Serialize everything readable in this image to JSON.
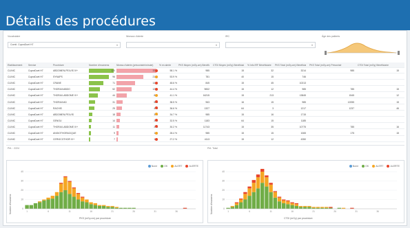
{
  "header": {
    "title": "Détails des procédures"
  },
  "filters": [
    {
      "label": "Vocabulaire",
      "value": "Comit. CupraDuet H7",
      "icon": "filter-icon"
    },
    {
      "label": "Niveaux d'alerte",
      "value": "",
      "icon": "chevron-down-icon"
    },
    {
      "label": "IRC",
      "value": "",
      "icon": "chevron-down-icon"
    },
    {
      "label": "Âge des patients",
      "value": "",
      "icon": ""
    }
  ],
  "table": {
    "columns": [
      "Établissement",
      "Service",
      "Procédure",
      "Nombre d'examens",
      "Niveau d'alerte (préconisée/minute)",
      "% en alerte",
      "PKS Moyen (mGy.cm) Bénéficiaire",
      "CTDI Moyen (mGy) Bénéficiaire",
      "% Info IRF Bénéficiaire",
      "PKS Total (mGy.cm) Bénéficiaire",
      "PKS Total (mGy.cm) Préconisé",
      "CTDI Total (mGy) Bénéficiaire"
    ],
    "rows": [
      [
        "CLINIC",
        "CupraDuet H7",
        "ABDOMEN-PELVIS IV+",
        120,
        3250,
        "58.1 %",
        "985",
        "15",
        "32",
        "3214",
        "985",
        "15"
      ],
      [
        "CLINIC",
        "CupraDuet H7",
        "SYNAPS",
        96,
        2160,
        "53.9 %",
        "781",
        "40",
        "15",
        "746",
        "",
        ""
      ],
      [
        "CLINIC",
        "CupraDuet H7",
        "CRANE",
        71,
        1485,
        "48.6 %",
        "845",
        "15",
        "45",
        "10213",
        "",
        ""
      ],
      [
        "CLINIC",
        "CupraDuet H7",
        "THORAX/ABDO",
        52,
        1210,
        "44.4 %",
        "9832",
        "15",
        "12",
        "985",
        "785",
        "15"
      ],
      [
        "CLINIC",
        "CupraDuet H7",
        "THORAX-ABDOME IV+",
        44,
        840,
        "41.1 %",
        "16215",
        "15",
        "213",
        "13845",
        "1545",
        "12"
      ],
      [
        "CLINIC",
        "CupraDuet H7",
        "THORAX/AD",
        31,
        525,
        "38.5 %",
        "963",
        "16",
        "15",
        "985",
        "12055",
        "15"
      ],
      [
        "CLINIC",
        "CupraDuet H7",
        "RACHIS",
        25,
        440,
        "36.6 %",
        "1327",
        "64",
        "3",
        "1217",
        "1237",
        "46"
      ],
      [
        "CLINIC",
        "CupraDuet H7",
        "ABDOMEN-PELVIS",
        18,
        310,
        "34.7 %",
        "985",
        "15",
        "16",
        "1715",
        "",
        ""
      ],
      [
        "CLINIC",
        "CupraDuet H7",
        "GENOU",
        14,
        260,
        "32.5 %",
        "1183",
        "64",
        "15",
        "1185",
        "",
        ""
      ],
      [
        "CLINIC",
        "CupraDuet H7",
        "THORAX-ABDOME IV+",
        11,
        215,
        "30.2 %",
        "11743",
        "15",
        "35",
        "10775",
        "785",
        "16"
      ],
      [
        "CLINIC",
        "CupraDuet H7",
        "ANGIOTHORACIQUE",
        9,
        180,
        "28.4 %",
        "985",
        "15",
        "15",
        "1065",
        "175",
        "15"
      ],
      [
        "CLINIC",
        "CupraDuet H7",
        "CERVICOTHOR IV+",
        7,
        140,
        "27.2 %",
        "4113",
        "15",
        "12",
        "4350",
        "",
        ""
      ]
    ],
    "footer": [
      "Prit. : 2224",
      "Prit. Total"
    ]
  },
  "chart_data": [
    {
      "type": "bar",
      "title": "",
      "xlabel": "PKS (mGy.cm) par procédure",
      "ylabel": "Nombre d'examens",
      "legend": [
        "None",
        "OK",
        "ALERT",
        "ALERTE"
      ],
      "colors": [
        "#5b9bd5",
        "#70ad47",
        "#f5a623",
        "#e8462b"
      ],
      "categories": [
        "1",
        "2",
        "3",
        "4",
        "5",
        "6",
        "7",
        "8",
        "9",
        "10",
        "11",
        "12",
        "13",
        "14",
        "15",
        "16",
        "17",
        "18",
        "19",
        "20",
        "21",
        "22",
        "23",
        "24",
        "25",
        "26",
        "27",
        "28",
        "29",
        "30",
        "31",
        "32",
        "33",
        "34",
        "35",
        "36",
        "37",
        "38",
        "39",
        "40"
      ],
      "series": [
        {
          "name": "OK",
          "values": [
            4,
            4,
            6,
            7,
            9,
            10,
            11,
            14,
            18,
            20,
            16,
            13,
            10,
            8,
            7,
            5,
            4,
            3,
            3,
            2,
            2,
            1,
            1,
            1,
            1,
            1,
            0,
            0,
            0,
            0,
            0,
            0,
            0,
            0,
            0,
            0,
            0,
            0,
            0,
            0
          ]
        },
        {
          "name": "ALERT",
          "values": [
            0,
            0,
            0,
            1,
            1,
            2,
            3,
            4,
            9,
            14,
            13,
            9,
            6,
            4,
            3,
            2,
            2,
            1,
            1,
            1,
            1,
            1,
            0,
            0,
            0,
            0,
            0,
            0,
            0,
            0,
            0,
            0,
            0,
            0,
            0,
            0,
            0,
            0,
            0,
            0
          ]
        },
        {
          "name": "ALERTE",
          "values": [
            0,
            0,
            0,
            0,
            0,
            0,
            0,
            0,
            1,
            1,
            1,
            1,
            1,
            1,
            0,
            0,
            0,
            0,
            0,
            0,
            0,
            0,
            0,
            0,
            0,
            0,
            0,
            0,
            0,
            0,
            0,
            0,
            0,
            0,
            0,
            0,
            0,
            1,
            0,
            0
          ]
        }
      ],
      "ylim": [
        0,
        40
      ]
    },
    {
      "type": "bar",
      "title": "",
      "xlabel": "CTDI (mGy) par procédure",
      "ylabel": "Nombre d'examens",
      "legend": [
        "None",
        "OK",
        "ALERT",
        "ALERTE"
      ],
      "colors": [
        "#5b9bd5",
        "#70ad47",
        "#f5a623",
        "#e8462b"
      ],
      "categories": [
        "1",
        "2",
        "3",
        "4",
        "5",
        "6",
        "7",
        "8",
        "9",
        "10",
        "11",
        "12",
        "13",
        "14",
        "15",
        "16",
        "17",
        "18",
        "19",
        "20",
        "21",
        "22",
        "23",
        "24",
        "25",
        "26",
        "27",
        "28",
        "29",
        "30",
        "31",
        "32",
        "33",
        "34",
        "35",
        "36",
        "37",
        "38",
        "39",
        "40"
      ],
      "series": [
        {
          "name": "OK",
          "values": [
            1,
            2,
            4,
            7,
            10,
            14,
            18,
            22,
            28,
            24,
            18,
            12,
            8,
            6,
            5,
            4,
            3,
            2,
            2,
            2,
            1,
            1,
            1,
            1,
            1,
            0,
            1,
            0,
            0,
            0,
            0,
            0,
            0,
            0,
            0,
            0,
            0,
            0,
            0,
            0
          ]
        },
        {
          "name": "ALERT",
          "values": [
            0,
            1,
            2,
            3,
            6,
            8,
            10,
            12,
            12,
            10,
            8,
            6,
            4,
            3,
            3,
            2,
            2,
            1,
            1,
            1,
            1,
            1,
            1,
            1,
            0,
            0,
            0,
            1,
            0,
            0,
            0,
            0,
            0,
            0,
            0,
            0,
            0,
            0,
            0,
            0
          ]
        },
        {
          "name": "ALERTE",
          "values": [
            0,
            0,
            1,
            1,
            2,
            2,
            3,
            3,
            3,
            2,
            2,
            1,
            1,
            1,
            1,
            1,
            1,
            0,
            0,
            0,
            0,
            0,
            0,
            0,
            1,
            0,
            0,
            0,
            0,
            1,
            0,
            0,
            0,
            0,
            0,
            0,
            0,
            0,
            0,
            0
          ]
        }
      ],
      "ylim": [
        0,
        40
      ]
    }
  ]
}
